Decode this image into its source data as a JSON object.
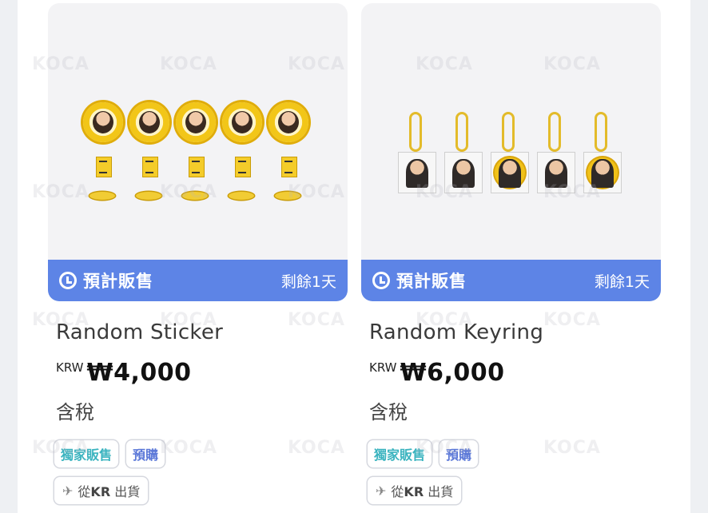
{
  "products": [
    {
      "name": "Random Sticker",
      "currency": "KRW",
      "price": "₩4,000",
      "tax_note": "含稅",
      "banner_label": "預計販售",
      "banner_days": "剩餘1天",
      "tags": [
        "獨家販售",
        "預購"
      ],
      "shipping": {
        "prefix": "從",
        "country": "KR",
        "suffix": "出貨"
      }
    },
    {
      "name": "Random Keyring",
      "currency": "KRW",
      "price": "₩6,000",
      "tax_note": "含稅",
      "banner_label": "預計販售",
      "banner_days": "剩餘1天",
      "tags": [
        "獨家販售",
        "預購"
      ],
      "shipping": {
        "prefix": "從",
        "country": "KR",
        "suffix": "出貨"
      }
    }
  ],
  "watermark": "KOCA",
  "colors": {
    "banner": "#5d84e6",
    "tag_exclusive": "#3ab3bf",
    "tag_preorder": "#5b78d8"
  }
}
